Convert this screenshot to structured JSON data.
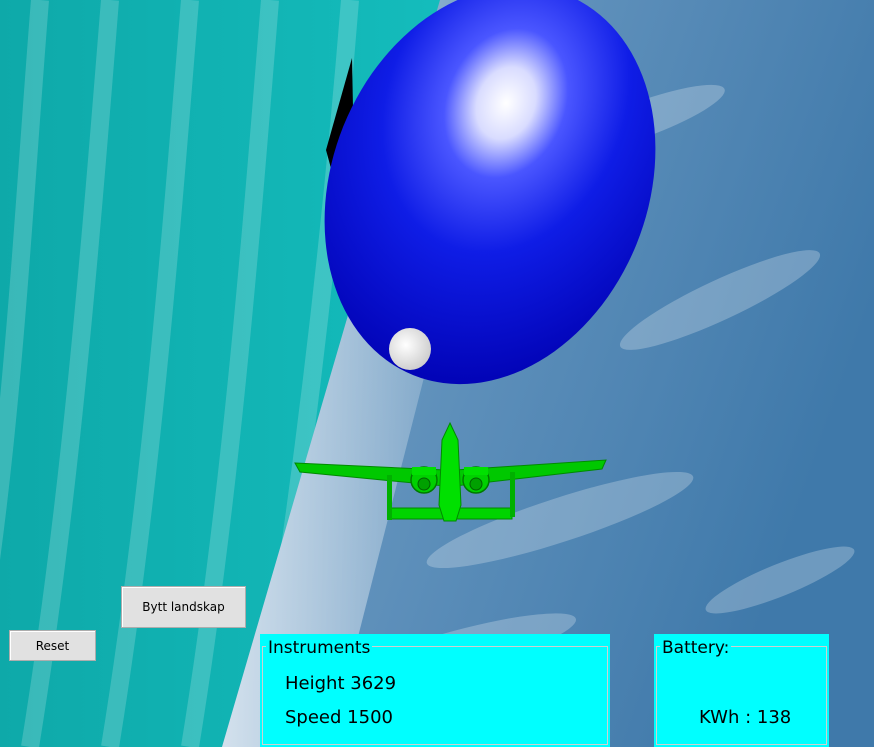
{
  "controls": {
    "change_landscape_label": "Bytt landskap",
    "reset_label": "Reset"
  },
  "instruments": {
    "title": "Instruments",
    "height_label": "Height",
    "height_value": "3629",
    "speed_label": "Speed",
    "speed_value": "1500"
  },
  "battery": {
    "title": "Battery:",
    "kwh_label": "KWh :",
    "kwh_value": "138"
  },
  "colors": {
    "sky": "#12b3b3",
    "ground": "#5f8db8",
    "balloon": "#0a10e0",
    "plane": "#00d000",
    "panel": "#00ffff"
  }
}
